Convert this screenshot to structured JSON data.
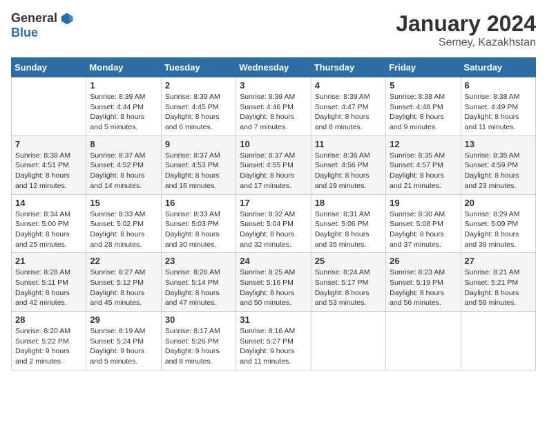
{
  "logo": {
    "general": "General",
    "blue": "Blue"
  },
  "title": "January 2024",
  "subtitle": "Semey, Kazakhstan",
  "days_header": [
    "Sunday",
    "Monday",
    "Tuesday",
    "Wednesday",
    "Thursday",
    "Friday",
    "Saturday"
  ],
  "weeks": [
    [
      {
        "day": "",
        "sunrise": "",
        "sunset": "",
        "daylight": ""
      },
      {
        "day": "1",
        "sunrise": "Sunrise: 8:39 AM",
        "sunset": "Sunset: 4:44 PM",
        "daylight": "Daylight: 8 hours and 5 minutes."
      },
      {
        "day": "2",
        "sunrise": "Sunrise: 8:39 AM",
        "sunset": "Sunset: 4:45 PM",
        "daylight": "Daylight: 8 hours and 6 minutes."
      },
      {
        "day": "3",
        "sunrise": "Sunrise: 8:39 AM",
        "sunset": "Sunset: 4:46 PM",
        "daylight": "Daylight: 8 hours and 7 minutes."
      },
      {
        "day": "4",
        "sunrise": "Sunrise: 8:39 AM",
        "sunset": "Sunset: 4:47 PM",
        "daylight": "Daylight: 8 hours and 8 minutes."
      },
      {
        "day": "5",
        "sunrise": "Sunrise: 8:38 AM",
        "sunset": "Sunset: 4:48 PM",
        "daylight": "Daylight: 8 hours and 9 minutes."
      },
      {
        "day": "6",
        "sunrise": "Sunrise: 8:38 AM",
        "sunset": "Sunset: 4:49 PM",
        "daylight": "Daylight: 8 hours and 11 minutes."
      }
    ],
    [
      {
        "day": "7",
        "sunrise": "Sunrise: 8:38 AM",
        "sunset": "Sunset: 4:51 PM",
        "daylight": "Daylight: 8 hours and 12 minutes."
      },
      {
        "day": "8",
        "sunrise": "Sunrise: 8:37 AM",
        "sunset": "Sunset: 4:52 PM",
        "daylight": "Daylight: 8 hours and 14 minutes."
      },
      {
        "day": "9",
        "sunrise": "Sunrise: 8:37 AM",
        "sunset": "Sunset: 4:53 PM",
        "daylight": "Daylight: 8 hours and 16 minutes."
      },
      {
        "day": "10",
        "sunrise": "Sunrise: 8:37 AM",
        "sunset": "Sunset: 4:55 PM",
        "daylight": "Daylight: 8 hours and 17 minutes."
      },
      {
        "day": "11",
        "sunrise": "Sunrise: 8:36 AM",
        "sunset": "Sunset: 4:56 PM",
        "daylight": "Daylight: 8 hours and 19 minutes."
      },
      {
        "day": "12",
        "sunrise": "Sunrise: 8:35 AM",
        "sunset": "Sunset: 4:57 PM",
        "daylight": "Daylight: 8 hours and 21 minutes."
      },
      {
        "day": "13",
        "sunrise": "Sunrise: 8:35 AM",
        "sunset": "Sunset: 4:59 PM",
        "daylight": "Daylight: 8 hours and 23 minutes."
      }
    ],
    [
      {
        "day": "14",
        "sunrise": "Sunrise: 8:34 AM",
        "sunset": "Sunset: 5:00 PM",
        "daylight": "Daylight: 8 hours and 25 minutes."
      },
      {
        "day": "15",
        "sunrise": "Sunrise: 8:33 AM",
        "sunset": "Sunset: 5:02 PM",
        "daylight": "Daylight: 8 hours and 28 minutes."
      },
      {
        "day": "16",
        "sunrise": "Sunrise: 8:33 AM",
        "sunset": "Sunset: 5:03 PM",
        "daylight": "Daylight: 8 hours and 30 minutes."
      },
      {
        "day": "17",
        "sunrise": "Sunrise: 8:32 AM",
        "sunset": "Sunset: 5:04 PM",
        "daylight": "Daylight: 8 hours and 32 minutes."
      },
      {
        "day": "18",
        "sunrise": "Sunrise: 8:31 AM",
        "sunset": "Sunset: 5:06 PM",
        "daylight": "Daylight: 8 hours and 35 minutes."
      },
      {
        "day": "19",
        "sunrise": "Sunrise: 8:30 AM",
        "sunset": "Sunset: 5:08 PM",
        "daylight": "Daylight: 8 hours and 37 minutes."
      },
      {
        "day": "20",
        "sunrise": "Sunrise: 8:29 AM",
        "sunset": "Sunset: 5:09 PM",
        "daylight": "Daylight: 8 hours and 39 minutes."
      }
    ],
    [
      {
        "day": "21",
        "sunrise": "Sunrise: 8:28 AM",
        "sunset": "Sunset: 5:11 PM",
        "daylight": "Daylight: 8 hours and 42 minutes."
      },
      {
        "day": "22",
        "sunrise": "Sunrise: 8:27 AM",
        "sunset": "Sunset: 5:12 PM",
        "daylight": "Daylight: 8 hours and 45 minutes."
      },
      {
        "day": "23",
        "sunrise": "Sunrise: 8:26 AM",
        "sunset": "Sunset: 5:14 PM",
        "daylight": "Daylight: 8 hours and 47 minutes."
      },
      {
        "day": "24",
        "sunrise": "Sunrise: 8:25 AM",
        "sunset": "Sunset: 5:16 PM",
        "daylight": "Daylight: 8 hours and 50 minutes."
      },
      {
        "day": "25",
        "sunrise": "Sunrise: 8:24 AM",
        "sunset": "Sunset: 5:17 PM",
        "daylight": "Daylight: 8 hours and 53 minutes."
      },
      {
        "day": "26",
        "sunrise": "Sunrise: 8:23 AM",
        "sunset": "Sunset: 5:19 PM",
        "daylight": "Daylight: 8 hours and 56 minutes."
      },
      {
        "day": "27",
        "sunrise": "Sunrise: 8:21 AM",
        "sunset": "Sunset: 5:21 PM",
        "daylight": "Daylight: 8 hours and 59 minutes."
      }
    ],
    [
      {
        "day": "28",
        "sunrise": "Sunrise: 8:20 AM",
        "sunset": "Sunset: 5:22 PM",
        "daylight": "Daylight: 9 hours and 2 minutes."
      },
      {
        "day": "29",
        "sunrise": "Sunrise: 8:19 AM",
        "sunset": "Sunset: 5:24 PM",
        "daylight": "Daylight: 9 hours and 5 minutes."
      },
      {
        "day": "30",
        "sunrise": "Sunrise: 8:17 AM",
        "sunset": "Sunset: 5:26 PM",
        "daylight": "Daylight: 9 hours and 8 minutes."
      },
      {
        "day": "31",
        "sunrise": "Sunrise: 8:16 AM",
        "sunset": "Sunset: 5:27 PM",
        "daylight": "Daylight: 9 hours and 11 minutes."
      },
      {
        "day": "",
        "sunrise": "",
        "sunset": "",
        "daylight": ""
      },
      {
        "day": "",
        "sunrise": "",
        "sunset": "",
        "daylight": ""
      },
      {
        "day": "",
        "sunrise": "",
        "sunset": "",
        "daylight": ""
      }
    ]
  ]
}
